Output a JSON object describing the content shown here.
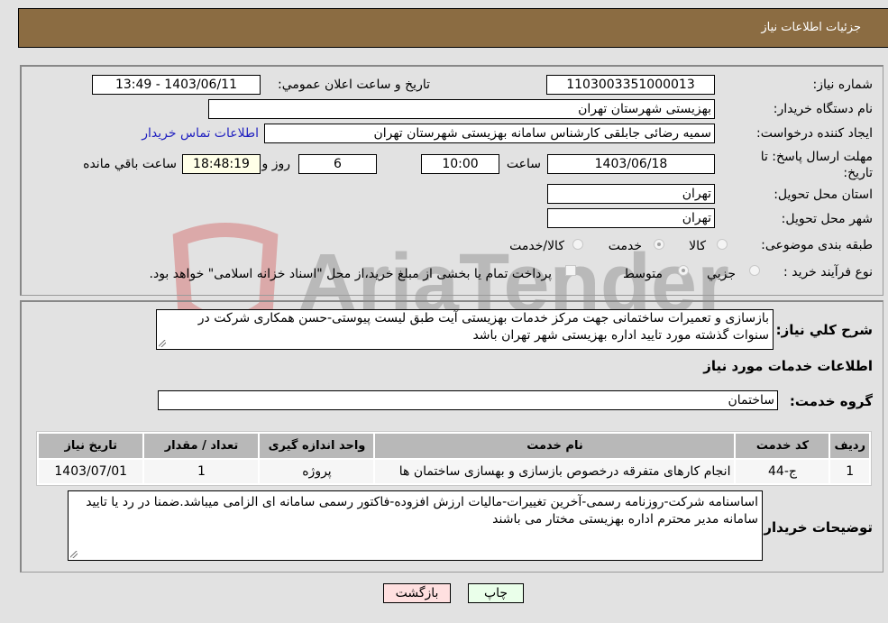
{
  "header": {
    "title": "جزئیات اطلاعات نیاز"
  },
  "form": {
    "need_number_label": "شماره نیاز:",
    "need_number": "1103003351000013",
    "announce_label": "تاریخ و ساعت اعلان عمومي:",
    "announce_value": "1403/06/11 - 13:49",
    "buyer_org_label": "نام دستگاه خریدار:",
    "buyer_org": "بهزیستی شهرستان تهران",
    "creator_label": "ایجاد کننده درخواست:",
    "creator": "سمیه رضائی جابلقی کارشناس  سامانه بهزیستی شهرستان تهران",
    "buyer_contact_link": "اطلاعات تماس خریدار",
    "deadline_label": "مهلت ارسال پاسخ: تا تاریخ:",
    "deadline_date": "1403/06/18",
    "time_label": "ساعت",
    "deadline_time": "10:00",
    "days_value": "6",
    "days_label": "روز و",
    "remaining_time": "18:48:19",
    "remaining_label": "ساعت باقي مانده",
    "province_label": "استان محل تحویل:",
    "province": "تهران",
    "city_label": "شهر محل تحویل:",
    "city": "تهران",
    "category_label": "طبقه بندی موضوعی:",
    "category_options": [
      {
        "label": "کالا",
        "checked": false
      },
      {
        "label": "خدمت",
        "checked": true
      },
      {
        "label": "کالا/خدمت",
        "checked": false
      }
    ],
    "process_label": "نوع فرآیند خرید :",
    "process_options": [
      {
        "label": "جزيي",
        "checked": false
      },
      {
        "label": "متوسط",
        "checked": true
      }
    ],
    "treasury_note": "پرداخت تمام یا بخشی از مبلغ خرید،از محل \"اسناد خزانه اسلامی\" خواهد بود."
  },
  "description": {
    "label": "شرح کلي نياز:",
    "text": "بازسازی و تعمیرات ساختمانی جهت مرکز خدمات بهزیستی آیت طبق لیست پیوستی-حسن همکاری شرکت در سنوات گذشته مورد تایید اداره بهزیستی شهر تهران باشد"
  },
  "services": {
    "section_title": "اطلاعات خدمات مورد نیاز",
    "group_label": "گروه خدمت:",
    "group_value": "ساختمان",
    "table": {
      "headers": [
        "ردیف",
        "کد خدمت",
        "نام خدمت",
        "واحد اندازه گیری",
        "تعداد / مقدار",
        "تاریخ نیاز"
      ],
      "rows": [
        [
          "1",
          "ج-44",
          "انجام کارهای متفرقه درخصوص بازسازی و بهسازی ساختمان ها",
          "پروژه",
          "1",
          "1403/07/01"
        ]
      ]
    }
  },
  "buyer_notes": {
    "label": "توضیحات خریدار:",
    "text": "اساسنامه شرکت-روزنامه رسمی-آخرین تغییرات-مالیات ارزش افزوده-فاکتور رسمی سامانه ای الزامی میباشد.ضمنا در رد یا تایید سامانه مدیر محترم اداره بهزیستی مختار می باشند"
  },
  "buttons": {
    "print": "چاپ",
    "back": "بازگشت"
  },
  "watermark": {
    "text": "AriaTender.neT"
  },
  "colors": {
    "header_bg": "#8b6c42",
    "print_bg": "#eaffea",
    "back_bg": "#ffe0e0",
    "link": "#2020c0"
  }
}
